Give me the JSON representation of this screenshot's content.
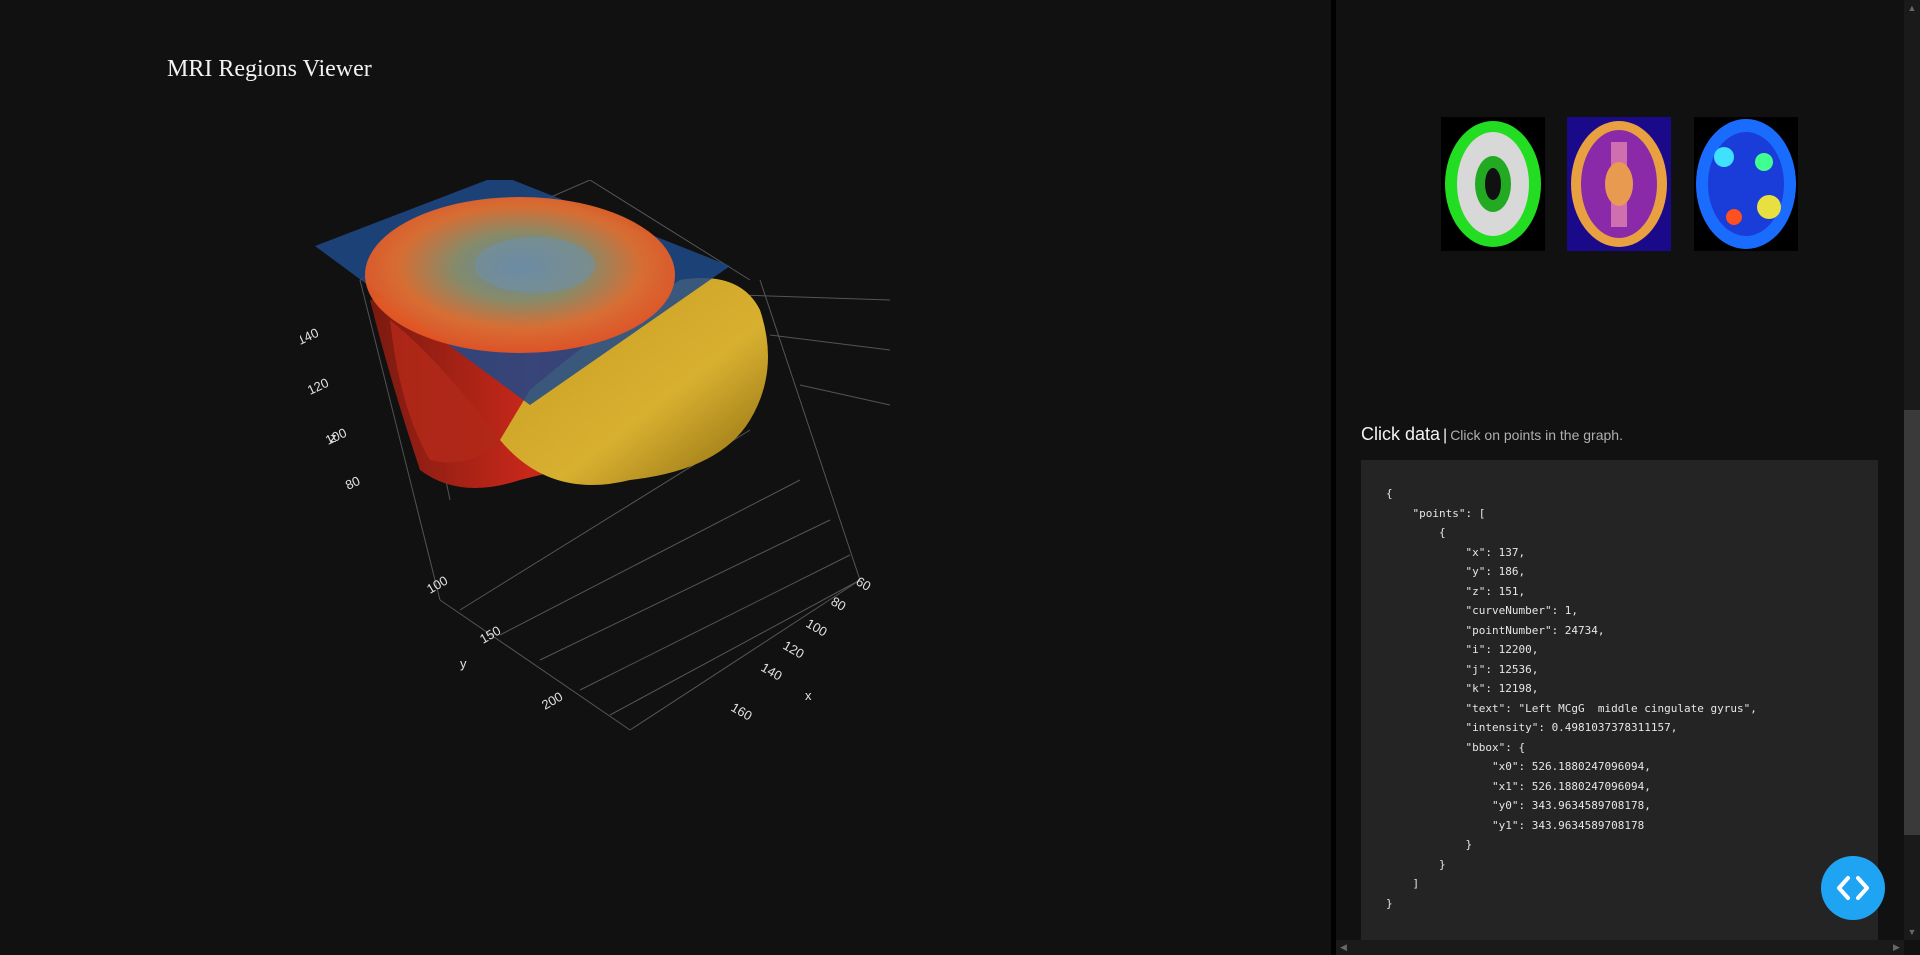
{
  "app": {
    "title": "MRI Regions Viewer"
  },
  "plot": {
    "axes": {
      "x": {
        "label": "x",
        "ticks": [
          "60",
          "80",
          "100",
          "120",
          "140",
          "160"
        ]
      },
      "y": {
        "label": "y",
        "ticks": [
          "100",
          "150",
          "200"
        ]
      },
      "z": {
        "label": "z",
        "ticks": [
          "80",
          "100",
          "120",
          "140"
        ]
      }
    }
  },
  "thumbnails": [
    {
      "name": "gray-matter-overlay",
      "color": "#22dd22"
    },
    {
      "name": "plasma-overlay",
      "color": "#d06fb0"
    },
    {
      "name": "jet-heatmap",
      "color": "#1a6cff"
    }
  ],
  "click_panel": {
    "heading": "Click data",
    "separator": "|",
    "subtitle": "Click on points in the graph.",
    "json_text": "{\n    \"points\": [\n        {\n            \"x\": 137,\n            \"y\": 186,\n            \"z\": 151,\n            \"curveNumber\": 1,\n            \"pointNumber\": 24734,\n            \"i\": 12200,\n            \"j\": 12536,\n            \"k\": 12198,\n            \"text\": \"Left MCgG  middle cingulate gyrus\",\n            \"intensity\": 0.4981037378311157,\n            \"bbox\": {\n                \"x0\": 526.1880247096094,\n                \"x1\": 526.1880247096094,\n                \"y0\": 343.9634589708178,\n                \"y1\": 343.9634589708178\n            }\n        }\n    ]\n}"
  },
  "colors": {
    "background": "#111111",
    "panel": "#242424",
    "fab": "#1fa3f3"
  },
  "icons": {
    "fab": "code-brackets-icon"
  }
}
